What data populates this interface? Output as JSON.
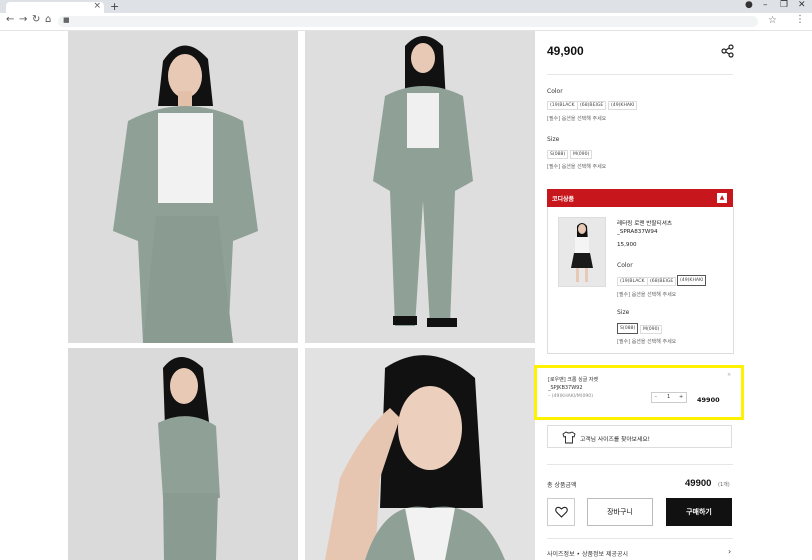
{
  "browser": {
    "new_tab": "+",
    "tab_close": "×",
    "win_min": "–",
    "win_max": "❐",
    "win_close": "✕",
    "back": "←",
    "forward": "→",
    "reload": "↻",
    "home": "⌂",
    "lock": "🔒",
    "star": "☆",
    "menu": "⋮"
  },
  "product": {
    "price": "49,900",
    "color_label": "Color",
    "colors": [
      "(19)BLACK",
      "(68)BEIGE",
      "(49)KHAKI"
    ],
    "color_hint": "[필수] 옵션을 선택해 주세요",
    "size_label": "Size",
    "sizes": [
      "S(088)",
      "M(090)"
    ],
    "size_hint": "[필수] 옵션을 선택해 주세요"
  },
  "coordi": {
    "title": "코디상품",
    "toggle": "▲",
    "name_line1": "레터링 로맨 반팔티셔츠",
    "name_line2": "_SPRA837W94",
    "price": "15,900",
    "color_label": "Color",
    "colors": [
      "(19)BLACK",
      "(68)BEIGE",
      "(49)KHAKI"
    ],
    "color_hint": "[필수] 옵션을 선택해 주세요",
    "size_label": "Size",
    "sizes": [
      "S(088)",
      "M(090)"
    ],
    "size_hint": "[필수] 옵션을 선택해 주세요"
  },
  "selected": {
    "name_line1": "[로우맨] 크롭 싱글 자켓",
    "name_line2": "_SPJKB37W92",
    "option": "– (49)KHAKI/M(090)",
    "qty_minus": "-",
    "qty_value": "1",
    "qty_plus": "+",
    "price": "49900",
    "close": "×"
  },
  "size_finder": "고객님 사이즈를 찾아보세요!",
  "total": {
    "label": "총 상품금액",
    "price": "49900",
    "count": "(1개)"
  },
  "buttons": {
    "wish": "♡",
    "cart": "장바구니",
    "buy": "구매하기"
  },
  "footer": {
    "link": "사이즈정보 • 상품정보 제공공시",
    "arrow": "›"
  }
}
